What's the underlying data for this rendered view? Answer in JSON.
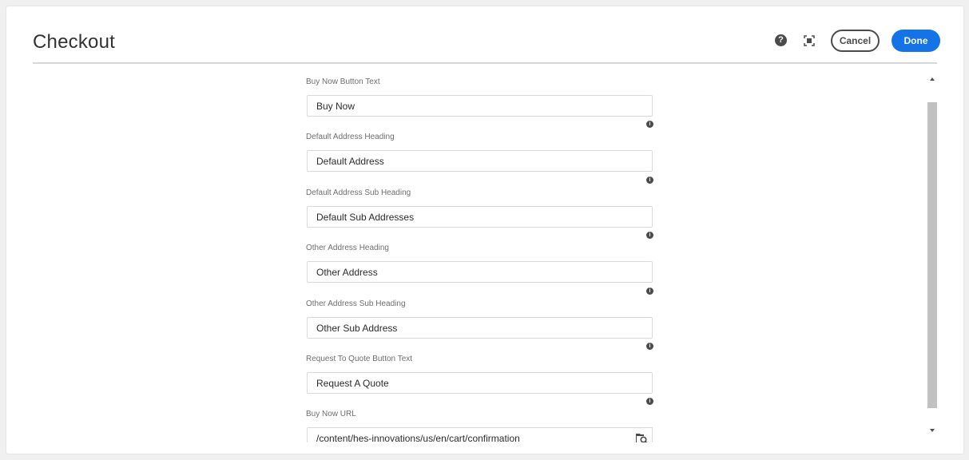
{
  "header": {
    "title": "Checkout",
    "help_icon": "help-circle-icon",
    "help_glyph": "?",
    "fullscreen_icon": "fullscreen-icon",
    "cancel_label": "Cancel",
    "done_label": "Done",
    "done_color": "#1473e6"
  },
  "fields": {
    "buy_now_text": {
      "label": "Buy Now Button Text",
      "value": "Buy Now"
    },
    "default_address_heading": {
      "label": "Default Address Heading",
      "value": "Default Address"
    },
    "default_address_sub_heading": {
      "label": "Default Address Sub Heading",
      "value": "Default Sub Addresses"
    },
    "other_address_heading": {
      "label": "Other Address Heading",
      "value": "Other Address"
    },
    "other_address_sub_heading": {
      "label": "Other Address Sub Heading",
      "value": "Other Sub Address"
    },
    "request_quote_text": {
      "label": "Request To Quote Button Text",
      "value": "Request A Quote"
    },
    "buy_now_url": {
      "label": "Buy Now URL",
      "value": "/content/hes-innovations/us/en/cart/confirmation",
      "browse_icon": "path-browser-icon"
    }
  },
  "info_icon": {
    "icon": "info-icon",
    "glyph": "i"
  },
  "scrollbar": {
    "up_icon": "scroll-up-arrow-icon",
    "down_icon": "scroll-down-arrow-icon"
  }
}
